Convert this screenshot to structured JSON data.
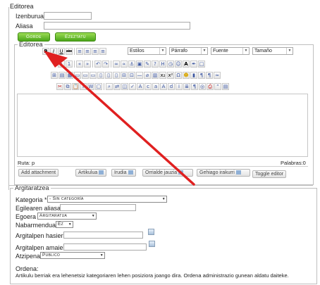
{
  "form": {
    "izenburua_label": "Izenburua *",
    "aliasa_label": "Aliasa",
    "gorde_label": "Gorde",
    "ezeztatu_label": "Ezeztatu"
  },
  "editor": {
    "legend": "Editorea",
    "styles": "Estilos",
    "paragraph": "Párrafo",
    "font": "Fuente",
    "size": "Tamaño",
    "path": "Ruta: p",
    "words": "Palabras:0",
    "buttons": {
      "add_attachment": "Add attachment",
      "artikulua": "Artikulua",
      "irudia": "Irudia",
      "orrialde": "Orrialde jauzia",
      "gehiago": "Gehiago irakurri",
      "toggle": "Toggle editor"
    }
  },
  "publish": {
    "legend": "Argitaratzea",
    "kategoria_label": "Kategoria *",
    "kategoria_value": "- Sin categoría",
    "egilearen_label": "Egilearen aliasa",
    "egoera_label": "Egoera",
    "egoera_value": "Argitaratua",
    "nabarmendua_label": "Nabarmendua",
    "nabarmendua_value": "Ez",
    "hasiera_label": "Argitalpen hasiera",
    "amaiera_label": "Argitalpen amaiera",
    "atzipena_label": "Atzipena",
    "atzipena_value": "Publico",
    "ordena_label": "Ordena:",
    "ordena_text": "Artikulu berriak era lehenetsiz kategoriaren lehen posiziora joango dira. Ordena administrazio gunean aldatu daiteke."
  },
  "colors": {
    "annotation_arrow": "#e02020",
    "save_green": "#4aa61a"
  }
}
